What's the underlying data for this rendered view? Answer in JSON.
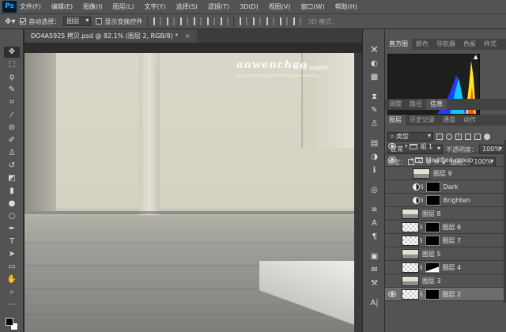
{
  "app": {
    "logo": "Ps"
  },
  "menu": [
    "文件(F)",
    "编辑(E)",
    "图像(I)",
    "图层(L)",
    "文字(Y)",
    "选择(S)",
    "滤镜(T)",
    "3D(D)",
    "视图(V)",
    "窗口(W)",
    "帮助(H)"
  ],
  "options": {
    "auto_select_label": "自动选择：",
    "auto_select_value": "图层",
    "transform_label": "显示变换控件",
    "mode_3d_label": "3D 模式："
  },
  "document": {
    "tab_title": "DO4A5925 拷贝.psd @ 82.1% (图层 2, RGB/8) *",
    "watermark": "anwenchao",
    "watermark_sub": "安文超 高端修图",
    "watermark_small": "Be focused on the professional high-end retouching"
  },
  "panels": {
    "top_tabs": [
      "直方图",
      "颜色",
      "导航器",
      "色板",
      "样式"
    ],
    "mid_tabs": [
      "调整",
      "路径",
      "信息"
    ],
    "layer_tabs": [
      "图层",
      "历史记录",
      "通道",
      "动作"
    ],
    "filter_kind": "类型",
    "blend_mode": "正常",
    "opacity_label": "不透明度：",
    "opacity_value": "100%",
    "lock_label": "锁定：",
    "fill_label": "填充：",
    "fill_value": "100%"
  },
  "layers": [
    {
      "name": "组 1",
      "kind": "group",
      "visible": true,
      "indent": 1,
      "selected": false
    },
    {
      "name": "Modified group",
      "kind": "group",
      "visible": true,
      "indent": 2,
      "selected": false
    },
    {
      "name": "图层 9",
      "kind": "photo",
      "visible": false,
      "indent": 3,
      "selected": false
    },
    {
      "name": "Dark",
      "kind": "adjust",
      "visible": false,
      "indent": 3,
      "selected": false
    },
    {
      "name": "Brighten",
      "kind": "adjust",
      "visible": false,
      "indent": 3,
      "selected": false
    },
    {
      "name": "图层 8",
      "kind": "photo",
      "visible": false,
      "indent": 1,
      "selected": false
    },
    {
      "name": "图层 6",
      "kind": "checker-mask",
      "visible": false,
      "indent": 1,
      "selected": false
    },
    {
      "name": "图层 7",
      "kind": "checker-mask",
      "visible": false,
      "indent": 1,
      "selected": false
    },
    {
      "name": "图层 5",
      "kind": "photo",
      "visible": false,
      "indent": 1,
      "selected": false
    },
    {
      "name": "图层 4",
      "kind": "checker-mixed",
      "visible": false,
      "indent": 1,
      "selected": false
    },
    {
      "name": "图层 3",
      "kind": "photo",
      "visible": false,
      "indent": 1,
      "selected": false
    },
    {
      "name": "图层 2",
      "kind": "checker-mask",
      "visible": true,
      "indent": 1,
      "selected": true
    }
  ],
  "colors": {
    "foreground": "#000000",
    "background": "#ffffff",
    "selection": "#6d6d6d"
  }
}
